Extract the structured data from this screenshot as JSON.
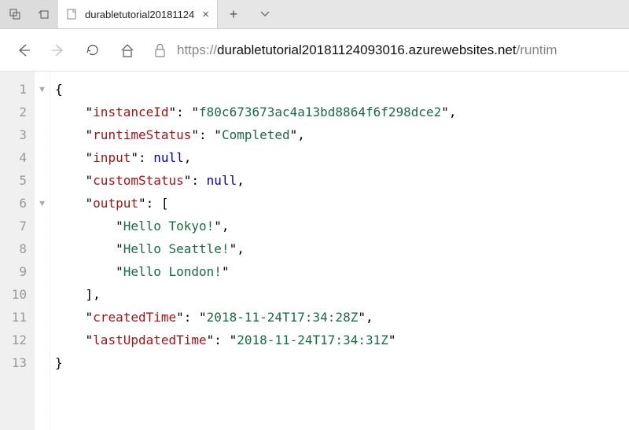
{
  "chrome": {
    "tab_title": "durabletutorial20181124"
  },
  "navbar": {
    "url_proto": "https://",
    "url_host": "durabletutorial20181124093016.azurewebsites.net",
    "url_path": "/runtim"
  },
  "code": {
    "line_count": 13,
    "keys": {
      "instanceId": "instanceId",
      "runtimeStatus": "runtimeStatus",
      "input": "input",
      "customStatus": "customStatus",
      "output": "output",
      "createdTime": "createdTime",
      "lastUpdatedTime": "lastUpdatedTime"
    },
    "vals": {
      "instanceId": "f80c673673ac4a13bd8864f6f298dce2",
      "runtimeStatus": "Completed",
      "input": "null",
      "customStatus": "null",
      "output0": "Hello Tokyo!",
      "output1": "Hello Seattle!",
      "output2": "Hello London!",
      "createdTime": "2018-11-24T17:34:28Z",
      "lastUpdatedTime": "2018-11-24T17:34:31Z"
    }
  }
}
